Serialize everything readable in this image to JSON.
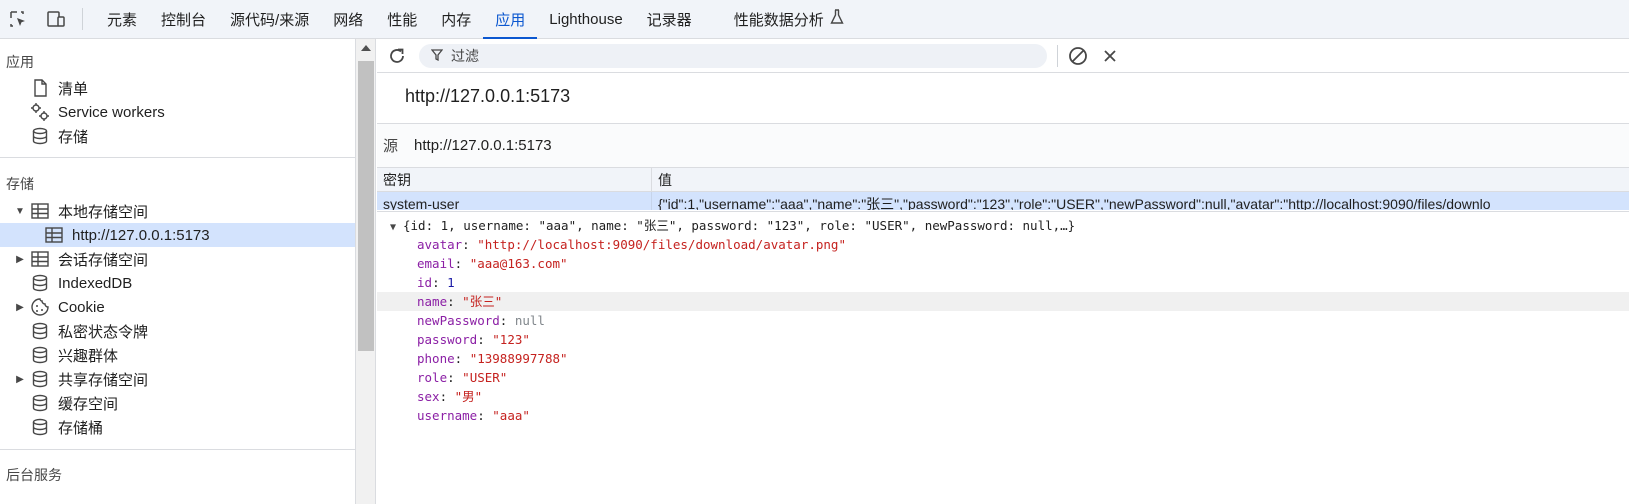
{
  "toolbar_icons": [
    "inspect-icon",
    "device-toggle-icon"
  ],
  "tabs": [
    {
      "label": "元素",
      "active": false
    },
    {
      "label": "控制台",
      "active": false
    },
    {
      "label": "源代码/来源",
      "active": false
    },
    {
      "label": "网络",
      "active": false
    },
    {
      "label": "性能",
      "active": false
    },
    {
      "label": "内存",
      "active": false
    },
    {
      "label": "应用",
      "active": true
    },
    {
      "label": "Lighthouse",
      "active": false
    },
    {
      "label": "记录器",
      "active": false
    },
    {
      "label": "性能数据分析",
      "active": false
    }
  ],
  "sidebar": {
    "section_app": "应用",
    "app_items": [
      {
        "label": "清单",
        "icon": "document-icon"
      },
      {
        "label": "Service workers",
        "icon": "gears-icon"
      },
      {
        "label": "存储",
        "icon": "database-icon"
      }
    ],
    "section_storage": "存储",
    "storage_items": [
      {
        "label": "本地存储空间",
        "icon": "table-icon",
        "expanded": true
      },
      {
        "label": "http://127.0.0.1:5173",
        "icon": "table-icon",
        "selected": true
      },
      {
        "label": "会话存储空间",
        "icon": "table-icon",
        "expanded": false
      },
      {
        "label": "IndexedDB",
        "icon": "database-icon"
      },
      {
        "label": "Cookie",
        "icon": "cookie-icon",
        "expanded": false
      },
      {
        "label": "私密状态令牌",
        "icon": "database-icon"
      },
      {
        "label": "兴趣群体",
        "icon": "database-icon"
      },
      {
        "label": "共享存储空间",
        "icon": "database-icon",
        "expanded": false
      },
      {
        "label": "缓存空间",
        "icon": "database-icon"
      },
      {
        "label": "存储桶",
        "icon": "database-icon"
      }
    ],
    "section_background": "后台服务"
  },
  "main": {
    "filter_placeholder": "过滤",
    "origin_title": "http://127.0.0.1:5173",
    "origin_label": "源",
    "origin_value": "http://127.0.0.1:5173",
    "col_key": "密钥",
    "col_value": "值",
    "row_key": "system-user",
    "row_value": "{\"id\":1,\"username\":\"aaa\",\"name\":\"张三\",\"password\":\"123\",\"role\":\"USER\",\"newPassword\":null,\"avatar\":\"http://localhost:9090/files/downlo",
    "preview_summary": "{id: 1, username: \"aaa\", name: \"张三\", password: \"123\", role: \"USER\", newPassword: null,…}",
    "props": [
      {
        "key": "avatar",
        "value": "\"http://localhost:9090/files/download/avatar.png\"",
        "type": "str"
      },
      {
        "key": "email",
        "value": "\"aaa@163.com\"",
        "type": "str"
      },
      {
        "key": "id",
        "value": "1",
        "type": "num"
      },
      {
        "key": "name",
        "value": "\"张三\"",
        "type": "str"
      },
      {
        "key": "newPassword",
        "value": "null",
        "type": "nul"
      },
      {
        "key": "password",
        "value": "\"123\"",
        "type": "str"
      },
      {
        "key": "phone",
        "value": "\"13988997788\"",
        "type": "str"
      },
      {
        "key": "role",
        "value": "\"USER\"",
        "type": "str"
      },
      {
        "key": "sex",
        "value": "\"男\"",
        "type": "str"
      },
      {
        "key": "username",
        "value": "\"aaa\"",
        "type": "str"
      }
    ]
  }
}
